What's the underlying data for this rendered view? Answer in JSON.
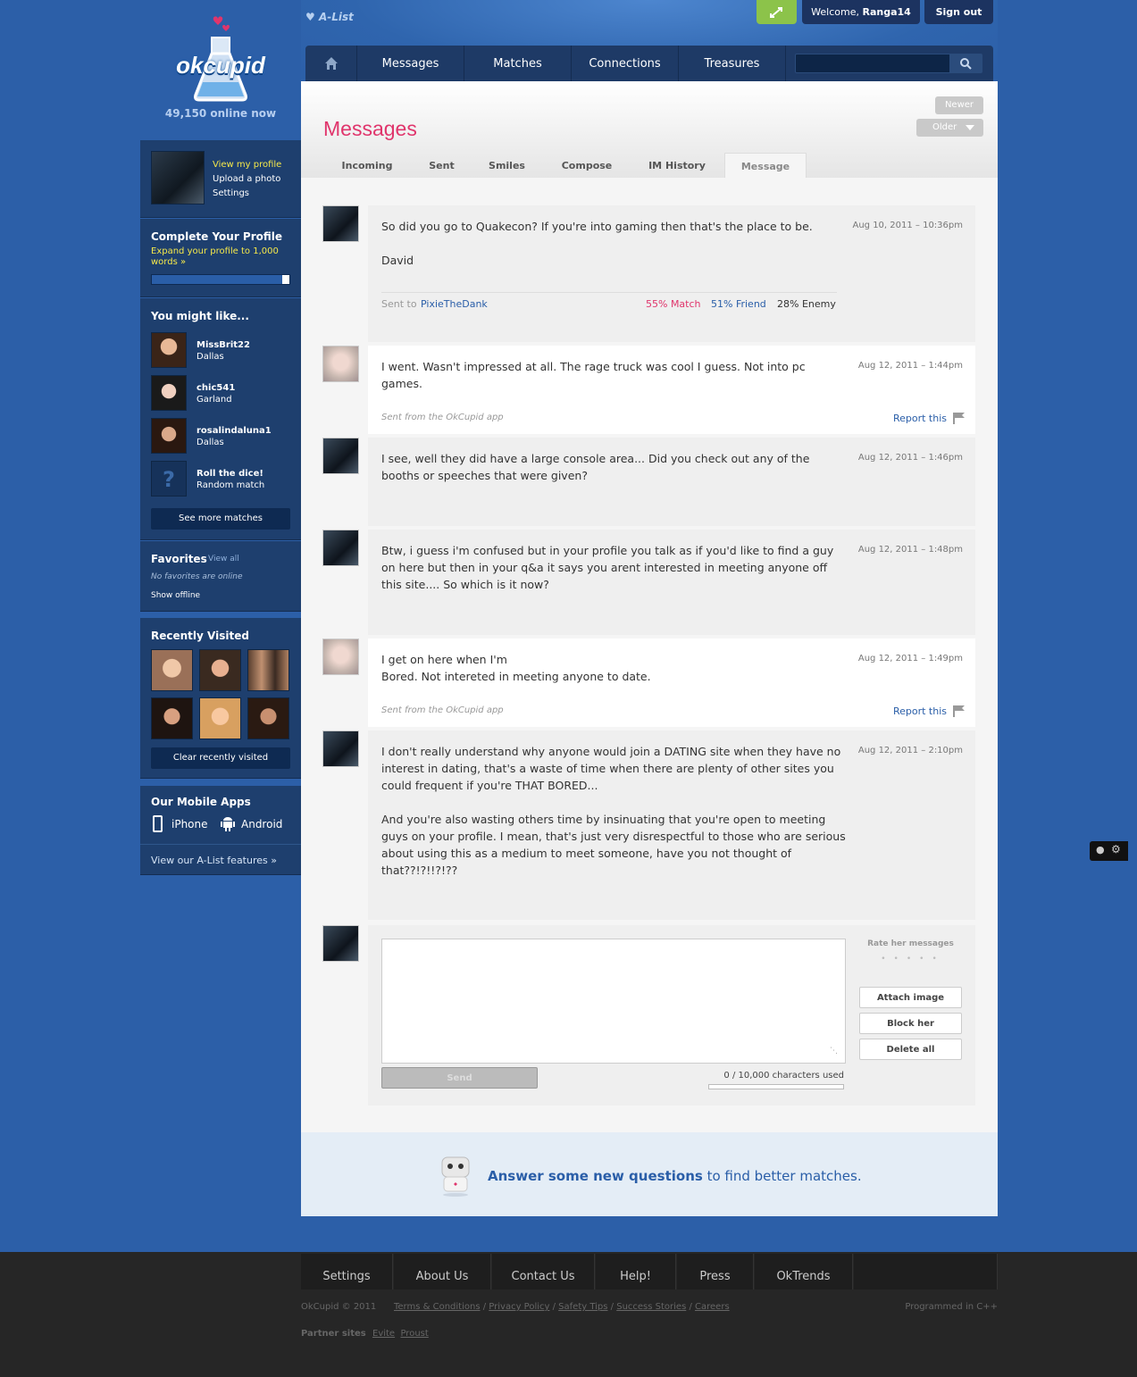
{
  "brand": {
    "logo_text": "okcupid",
    "online_count": "49,150 online now",
    "alist": "A-List"
  },
  "topbar": {
    "welcome_prefix": "Welcome,",
    "username": "Ranga14",
    "signout": "Sign out"
  },
  "nav": {
    "items": [
      "Messages",
      "Matches",
      "Connections",
      "Treasures"
    ],
    "search_placeholder": ""
  },
  "profile_links": {
    "view": "View my profile",
    "upload": "Upload a photo",
    "settings": "Settings"
  },
  "complete": {
    "title": "Complete Your Profile",
    "text": "Expand your profile to 1,000 words »",
    "progress": 0.95
  },
  "might_like": {
    "title": "You might like...",
    "users": [
      {
        "name": "MissBrit22",
        "city": "Dallas"
      },
      {
        "name": "chic541",
        "city": "Garland"
      },
      {
        "name": "rosalindaluna1",
        "city": "Dallas"
      },
      {
        "name": "Roll the dice!",
        "city": "Random match"
      }
    ],
    "see_more": "See more matches"
  },
  "favorites": {
    "title": "Favorites",
    "view_all": "View all",
    "none": "No favorites are online",
    "show_offline": "Show offline"
  },
  "recent": {
    "title": "Recently Visited",
    "clear": "Clear recently visited"
  },
  "mobile": {
    "title": "Our Mobile Apps",
    "iphone": "iPhone",
    "android": "Android",
    "alist_features": "View our A-List features »"
  },
  "page": {
    "title": "Messages",
    "newer": "Newer",
    "older": "Older",
    "tabs": [
      "Incoming",
      "Sent",
      "Smiles",
      "Compose",
      "IM History",
      "Message"
    ]
  },
  "thread": {
    "sent_to_label": "Sent to",
    "sent_to_user": "PixieTheDank",
    "match": "55% Match",
    "friend": "51% Friend",
    "enemy": "28% Enemy",
    "app_note": "Sent from the OkCupid app",
    "report": "Report this",
    "messages": [
      {
        "text": "So did you go to Quakecon? If you're into gaming then that's the place to be.\n\nDavid",
        "date": "Aug 10, 2011 – 10:36pm"
      },
      {
        "text": "I went. Wasn't impressed at all. The rage truck was cool I guess. Not into pc games.",
        "date": "Aug 12, 2011 – 1:44pm"
      },
      {
        "text": "I see, well they did have a large console area... Did you check out any of the booths or speeches that were given?",
        "date": "Aug 12, 2011 – 1:46pm"
      },
      {
        "text": "Btw, i guess i'm confused but in your profile you talk as if you'd like to find a guy on here but then in your q&a it says you arent interested in meeting anyone off this site.... So which is it now?",
        "date": "Aug 12, 2011 – 1:48pm"
      },
      {
        "text": "I get on here when I'm\nBored. Not intereted in meeting anyone to date.",
        "date": "Aug 12, 2011 – 1:49pm"
      },
      {
        "text": "I don't really understand why anyone would join a DATING site when they have no interest in dating, that's a waste of time when there are plenty of other sites you could frequent if you're THAT BORED...\n\nAnd you're also wasting others time by insinuating that you're open to meeting guys on your profile. I mean, that's just very disrespectful to those who are serious about using this as a medium to meet someone, have you not thought of that??!?!!?!??",
        "date": "Aug 12, 2011 – 2:10pm"
      }
    ]
  },
  "reply": {
    "send": "Send",
    "char_count": "0 / 10,000 characters used",
    "rate": "Rate her messages",
    "attach": "Attach image",
    "block": "Block her",
    "delete": "Delete all"
  },
  "promo": {
    "strong": "Answer some new questions",
    "rest": "to find better matches."
  },
  "footer": {
    "nav": [
      "Settings",
      "About Us",
      "Contact Us",
      "Help!",
      "Press",
      "OkTrends"
    ],
    "copyright": "OkCupid © 2011",
    "links": [
      "Terms & Conditions",
      "Privacy Policy",
      "Safety Tips",
      "Success Stories",
      "Careers"
    ],
    "programmed": "Programmed in C++",
    "partner_label": "Partner sites",
    "partners": [
      "Evite",
      "Proust"
    ]
  },
  "colors": {
    "accent_pink": "#e0356c",
    "link_blue": "#2a5ea8",
    "bg_blue": "#2c5fa8"
  }
}
